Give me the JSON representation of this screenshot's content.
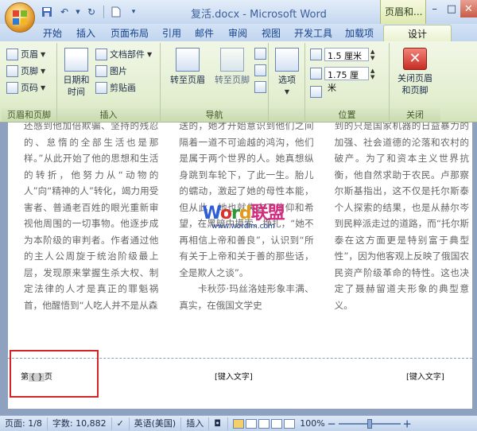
{
  "window": {
    "title": "复活.docx - Microsoft Word",
    "contextual_group": "页眉和...",
    "controls": {
      "minimize": "–",
      "maximize": "□",
      "close": "✕"
    }
  },
  "tabs": [
    {
      "label": "开始"
    },
    {
      "label": "插入"
    },
    {
      "label": "页面布局"
    },
    {
      "label": "引用"
    },
    {
      "label": "邮件"
    },
    {
      "label": "审阅"
    },
    {
      "label": "视图"
    },
    {
      "label": "开发工具"
    },
    {
      "label": "加载项"
    },
    {
      "label": "设计",
      "active": true
    }
  ],
  "ribbon": {
    "group_header_footer": {
      "label": "页眉和页脚",
      "header": "页眉",
      "footer": "页脚",
      "page_number": "页码"
    },
    "group_insert": {
      "label": "插入",
      "date_time": "日期和时间",
      "quick_parts": "文档部件",
      "picture": "图片",
      "clip_art": "剪贴画"
    },
    "group_navigation": {
      "label": "导航",
      "goto_header": "转至页眉",
      "goto_footer": "转至页脚"
    },
    "group_options": {
      "options": "选项"
    },
    "group_position": {
      "label": "位置",
      "header_position": "1.5 厘米",
      "footer_position": "1.75 厘米"
    },
    "group_close": {
      "label": "关闭",
      "close_header_footer": "关闭页眉和页脚"
    }
  },
  "document": {
    "columns": [
      "还感到他加倍欺骗、坚持的残忍的、怠惰的全部生活也是那样。”从此开始了他的思想和生活的转折，他努力从“动物的人”向“精神的人”转化，竭力用受害者、普通老百姓的眼光重新审视他周围的一切事物。他逐步成为本阶级的审判者。作者通过他的主人公周旋于统治阶级最上层，发现原来掌握生杀大权、制定法律的人才是真正的罪魁祸首，他醒悟到“人吃人并不是从森",
      "送的，她才开始意识到他们之间隔着一道不可逾越的鸿沟，他们是属于两个世界的人。她真想纵身跳到车轮下，了此一生。胎儿的蠕动，激起了她的母性本能，但从此，她也就失去了信仰和希望，在黑暗中摸索、挣扎，“她不再相信上帝和善良”，认识到“所有关于上帝和关于善的那些话，全是欺人之谈”。\n　　卡秋莎·玛丝洛娃形象丰满、真实，在俄国文学史",
      "到的只是国家机器的日益暴力的加强、社会道德的沦落和农村的破产。为了和资本主义世界抗衡，他自然求助于农民。卢那察尔斯基指出，这不仅是托尔斯泰个人探索的结果，也是从赫尔岑到民粹派走过的道路，而“托尔斯泰在这方面更是特别富于典型性”，因为他客观上反映了俄国农民资产阶级革命的特性。这也决定了聂赫留道夫形象的典型意义。"
    ],
    "watermark": {
      "text": "Word联盟",
      "url": "www.wordlm.com"
    },
    "footer": {
      "page_prefix": "第",
      "page_field": "{ }",
      "page_suffix": "页",
      "center": "[键入文字]",
      "right": "[键入文字]"
    }
  },
  "statusbar": {
    "page": "页面: 1/8",
    "words": "字数: 10,882",
    "language": "英语(美国)",
    "mode": "插入",
    "zoom": "100%",
    "zoom_minus": "－",
    "zoom_plus": "＋"
  },
  "colors": {
    "accent": "#15428b",
    "highlight": "#d62323",
    "watermark_w": "#2c5fd8",
    "watermark_o": "#d8322b",
    "watermark_r": "#2a9a36",
    "watermark_d": "#e39a17",
    "watermark_cn": "#d42a7f"
  }
}
